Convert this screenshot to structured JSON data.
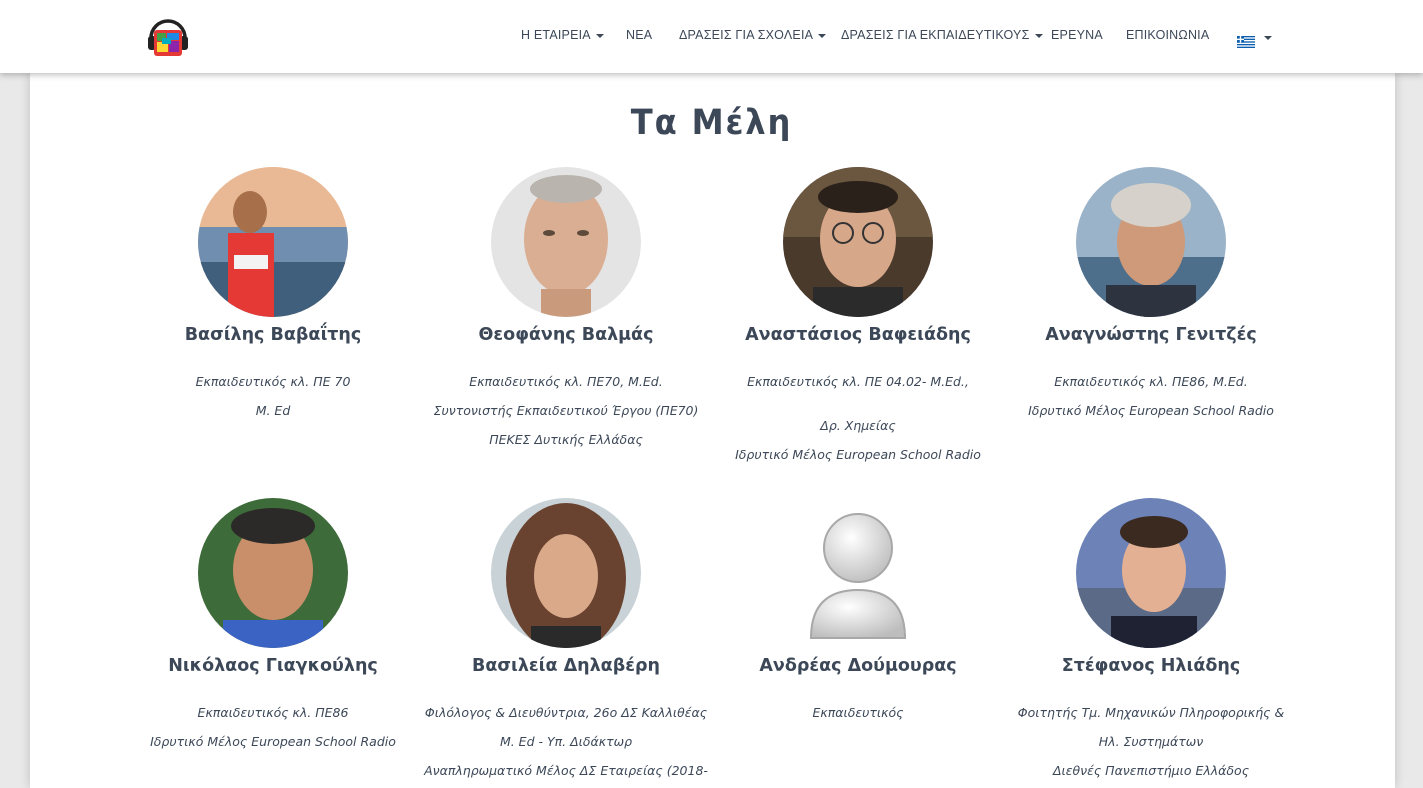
{
  "nav": {
    "items": [
      {
        "label": "Η ΕΤΑΙΡΕΙΑ",
        "dropdown": true
      },
      {
        "label": "ΝΕΑ",
        "dropdown": false
      },
      {
        "label": "ΔΡΑΣΕΙΣ ΓΙΑ ΣΧΟΛΕΙΑ",
        "dropdown": true
      },
      {
        "label": "ΔΡΑΣΕΙΣ ΓΙΑ ΕΚΠΑΙΔΕΥΤΙΚΟΥΣ",
        "dropdown": true
      },
      {
        "label": "ΕΡΕΥΝΑ",
        "dropdown": false
      },
      {
        "label": "ΕΠΙΚΟΙΝΩΝΙΑ",
        "dropdown": false
      }
    ],
    "language_icon": "greek-flag-icon"
  },
  "page": {
    "title": "Τα Μέλη"
  },
  "members": [
    {
      "name": "Βασίλης Βαβαΐτης",
      "lines": [
        "Εκπαιδευτικός κλ. ΠΕ 70",
        "Μ. Ed"
      ]
    },
    {
      "name": "Θεοφάνης Βαλμάς",
      "lines": [
        "Εκπαιδευτικός κλ. ΠΕ70, M.Ed.",
        "Συντονιστής Εκπαιδευτικού Έργου (ΠΕ70)",
        "ΠΕΚΕΣ Δυτικής Ελλάδας"
      ]
    },
    {
      "name": "Αναστάσιος Βαφειάδης",
      "lines": [
        "Εκπαιδευτικός κλ. ΠΕ 04.02- M.Ed.,",
        "",
        "Δρ. Χημείας",
        "Ιδρυτικό Μέλος European School Radio"
      ]
    },
    {
      "name": "Αναγνώστης Γενιτζές",
      "lines": [
        "Εκπαιδευτικός κλ. ΠΕ86, M.Ed.",
        "Ιδρυτικό Μέλος European School Radio"
      ]
    },
    {
      "name": "Νικόλαος Γιαγκούλης",
      "lines": [
        "Εκπαιδευτικός κλ. ΠΕ86",
        "Ιδρυτικό Μέλος European School Radio"
      ]
    },
    {
      "name": "Βασιλεία Δηλαβέρη",
      "lines": [
        "Φιλόλογος & Διευθύντρια, 26ο ΔΣ Καλλιθέας",
        "Μ. Ed - Υπ. Διδάκτωρ",
        "Αναπληρωματικό Μέλος ΔΣ Εταιρείας (2018-"
      ]
    },
    {
      "name": "Ανδρέας Δούμουρας",
      "lines": [
        "Εκπαιδευτικός"
      ]
    },
    {
      "name": "Στέφανος Ηλιάδης",
      "lines": [
        "Φοιτητής Τμ. Μηχανικών Πληροφορικής &",
        "Ηλ. Συστημάτων",
        "Διεθνές Πανεπιστήμιο Ελλάδος"
      ]
    }
  ]
}
